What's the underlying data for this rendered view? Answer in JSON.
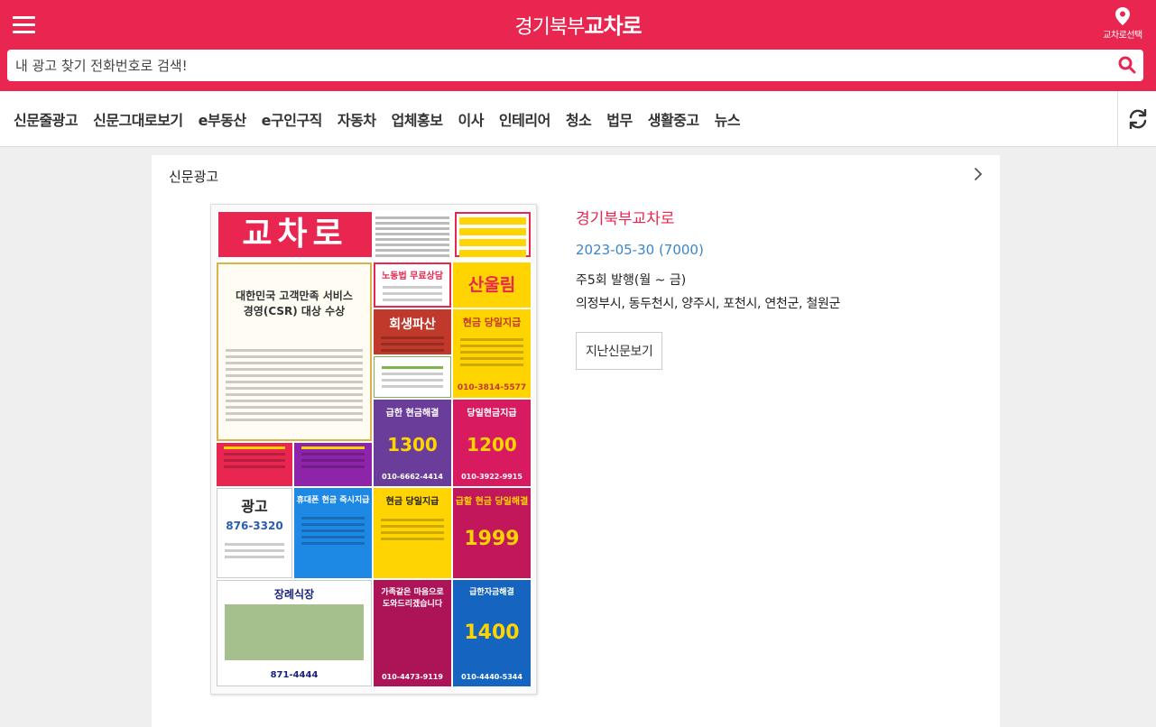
{
  "header": {
    "logo_region": "경기북부",
    "logo_brand": "교차로",
    "location_label": "교차로선택",
    "menu_icon": "hamburger-icon",
    "location_icon": "map-pin-icon"
  },
  "search": {
    "placeholder": "내 광고 찾기 전화번호로 검색!",
    "value": "",
    "icon": "search-icon"
  },
  "nav": {
    "items": [
      "신문줄광고",
      "신문그대로보기",
      "e부동산",
      "e구인구직",
      "자동차",
      "업체홍보",
      "이사",
      "인테리어",
      "청소",
      "법무",
      "생활중고",
      "뉴스"
    ],
    "refresh_icon": "refresh-icon"
  },
  "card": {
    "title": "신문광고",
    "arrow_icon": "chevron-right-icon",
    "paper_masthead": "교차로",
    "paper_blocks": [
      "대한민국 고객만족 서비스 경영(CSR) 대상 수상",
      "노동법 무료상담",
      "산울림",
      "회생파산",
      "현금 당일지급",
      "010-3814-5577",
      "급한 현금해결",
      "당일현금지급",
      "1300",
      "1200",
      "010-6662-4414",
      "010-3922-9915",
      "광고",
      "876-3320",
      "휴대폰 현금 즉시지급",
      "현금 당일지급",
      "급할 현금 당일해결",
      "1999",
      "장례식장",
      "871-4444",
      "가족같은 마음으로 도와드리겠습니다",
      "급한자금해결",
      "1400",
      "010-4473-9119",
      "010-4440-5344"
    ],
    "name": "경기북부교차로",
    "date": "2023-05-30 (7000)",
    "schedule": "주5회 발행(월 ~ 금)",
    "areas": "의정부시, 동두천시, 양주시, 포천시, 연천군, 철원군",
    "past_button": "지난신문보기"
  },
  "colors": {
    "brand": "#e8264f",
    "date_link": "#3a86c8",
    "background": "#efefef"
  }
}
